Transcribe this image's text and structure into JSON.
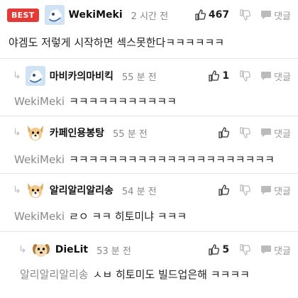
{
  "comments": [
    {
      "best_badge": "BEST",
      "author": "WekiMeki",
      "time": "2 시간 전",
      "likes": "467",
      "reply_label": "댓글",
      "mention": "",
      "text": "야겜도 저렇게 시작하면 섹스못한다ㅋㅋㅋㅋㅋㅋ",
      "avatar": "cartoon-avatar"
    },
    {
      "author": "마비카의마비킥",
      "time": "55 분 전",
      "likes": "1",
      "reply_label": "댓글",
      "mention": "WekiMeki",
      "text": "ㅋㅋㅋㅋㅋㅋㅋㅋㅋㅋㅋ",
      "avatar": "cartoon-avatar"
    },
    {
      "author": "카페인용봉탕",
      "time": "55 분 전",
      "likes": "",
      "reply_label": "댓글",
      "mention": "WekiMeki",
      "text": "ㅋㅋㅋㅋㅋㅋㅋㅋㅋㅋㅋㅋㅋㅋㅋㅋㅋㅋㅋㅋㅋ",
      "avatar": "dog-avatar"
    },
    {
      "author": "알리알리알리송",
      "time": "54 분 전",
      "likes": "",
      "reply_label": "댓글",
      "mention": "WekiMeki",
      "text": "ㄹㅇ ㅋㅋ 히토미냐 ㅋㅋㅋ",
      "avatar": "dog-avatar"
    },
    {
      "author": "DieLit",
      "time": "53 분 전",
      "likes": "5",
      "reply_label": "댓글",
      "mention": "알리알리알리송",
      "text": "ㅅㅂ 히토미도 빌드업은해 ㅋㅋㅋㅋ",
      "avatar": "puppy-avatar"
    }
  ],
  "colors": {
    "best_badge": "#e53935",
    "mention": "#888888",
    "divider": "#e6e6e6"
  }
}
